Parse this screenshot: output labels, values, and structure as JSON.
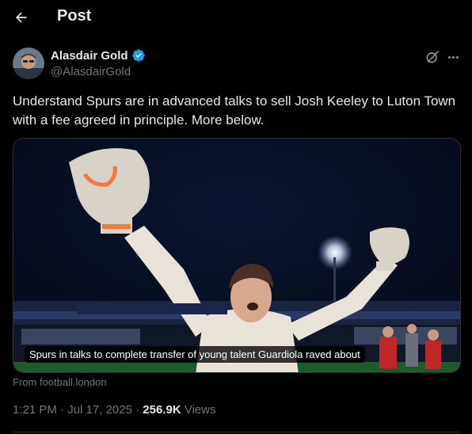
{
  "header": {
    "title": "Post",
    "back_icon": "arrow-left-icon"
  },
  "author": {
    "display_name": "Alasdair Gold",
    "handle": "@AlasdairGold",
    "verified": true,
    "verified_color": "#1d9bf0"
  },
  "actions": {
    "grok_icon": "grok-icon",
    "more_icon": "more-icon"
  },
  "tweet": {
    "text": "Understand Spurs are in advanced talks to sell Josh Keeley to Luton Town with a fee agreed in principle. More below."
  },
  "card": {
    "caption": "Spurs in talks to complete transfer of young talent Guardiola raved about",
    "source": "From football.london"
  },
  "meta": {
    "time": "1:21 PM",
    "separator": "·",
    "date": "Jul 17, 2025",
    "views_count": "256.9K",
    "views_label": "Views"
  }
}
